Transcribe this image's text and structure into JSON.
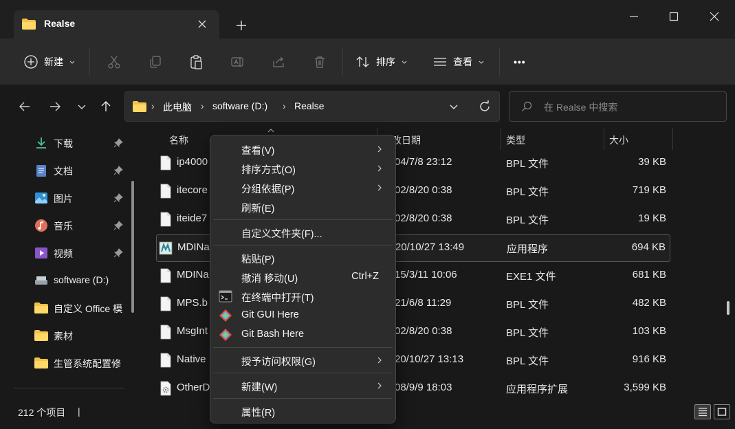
{
  "window": {
    "tab_title": "Realse",
    "new_tab": "+",
    "minimize": "─",
    "maximize": "□",
    "close": "✕"
  },
  "toolbar": {
    "new_label": "新建",
    "sort_label": "排序",
    "view_label": "查看",
    "more_label": "•••"
  },
  "address": {
    "crumbs": [
      "此电脑",
      "software (D:)",
      "Realse"
    ],
    "separator": "›",
    "search_placeholder": "在 Realse 中搜索"
  },
  "sidebar": {
    "items": [
      {
        "label": "下载",
        "icon": "download-icon",
        "pinned": true
      },
      {
        "label": "文档",
        "icon": "document-icon",
        "pinned": true
      },
      {
        "label": "图片",
        "icon": "picture-icon",
        "pinned": true
      },
      {
        "label": "音乐",
        "icon": "music-icon",
        "pinned": true
      },
      {
        "label": "视频",
        "icon": "video-icon",
        "pinned": true
      },
      {
        "label": "software (D:)",
        "icon": "drive-icon",
        "pinned": false
      },
      {
        "label": "自定义 Office 模",
        "icon": "folder-icon",
        "pinned": false
      },
      {
        "label": "素材",
        "icon": "folder-icon",
        "pinned": false
      },
      {
        "label": "生管系统配置修",
        "icon": "folder-icon",
        "pinned": false
      }
    ]
  },
  "columns": {
    "name": "名称",
    "date": "修改日期",
    "type": "类型",
    "size": "大小"
  },
  "files": [
    {
      "name": "ip4000",
      "date": "04/7/8 23:12",
      "type": "BPL 文件",
      "size": "39 KB",
      "icon": "file-icon"
    },
    {
      "name": "itecore",
      "date": "02/8/20 0:38",
      "type": "BPL 文件",
      "size": "719 KB",
      "icon": "file-icon"
    },
    {
      "name": "iteide7",
      "date": "02/8/20 0:38",
      "type": "BPL 文件",
      "size": "19 KB",
      "icon": "file-icon"
    },
    {
      "name": "MDINa",
      "date": "20/10/27 13:49",
      "type": "应用程序",
      "size": "694 KB",
      "icon": "app-icon",
      "selected": true
    },
    {
      "name": "MDINa",
      "date": "15/3/11 10:06",
      "type": "EXE1 文件",
      "size": "681 KB",
      "icon": "file-icon"
    },
    {
      "name": "MPS.b",
      "date": "21/6/8 11:29",
      "type": "BPL 文件",
      "size": "482 KB",
      "icon": "file-icon"
    },
    {
      "name": "MsgInt",
      "date": "02/8/20 0:38",
      "type": "BPL 文件",
      "size": "103 KB",
      "icon": "file-icon"
    },
    {
      "name": "Native",
      "date": "20/10/27 13:13",
      "type": "BPL 文件",
      "size": "916 KB",
      "icon": "file-icon"
    },
    {
      "name": "OtherD",
      "date": "08/9/9 18:03",
      "type": "应用程序扩展",
      "size": "3,599 KB",
      "icon": "dll-icon"
    }
  ],
  "status": {
    "count": "212 个项目",
    "separator": "|"
  },
  "context_menu": {
    "view": "查看(V)",
    "sort": "排序方式(O)",
    "group": "分组依据(P)",
    "refresh": "刷新(E)",
    "customize": "自定义文件夹(F)...",
    "paste": "粘贴(P)",
    "undo": "撤消 移动(U)",
    "undo_shortcut": "Ctrl+Z",
    "terminal": "在终端中打开(T)",
    "git_gui": "Git GUI Here",
    "git_bash": "Git Bash Here",
    "access": "授予访问权限(G)",
    "new": "新建(W)",
    "properties": "属性(R)"
  },
  "colors": {
    "folder": "#f3c24a",
    "accent": "#4cc2ff",
    "git": "#e84e31"
  }
}
